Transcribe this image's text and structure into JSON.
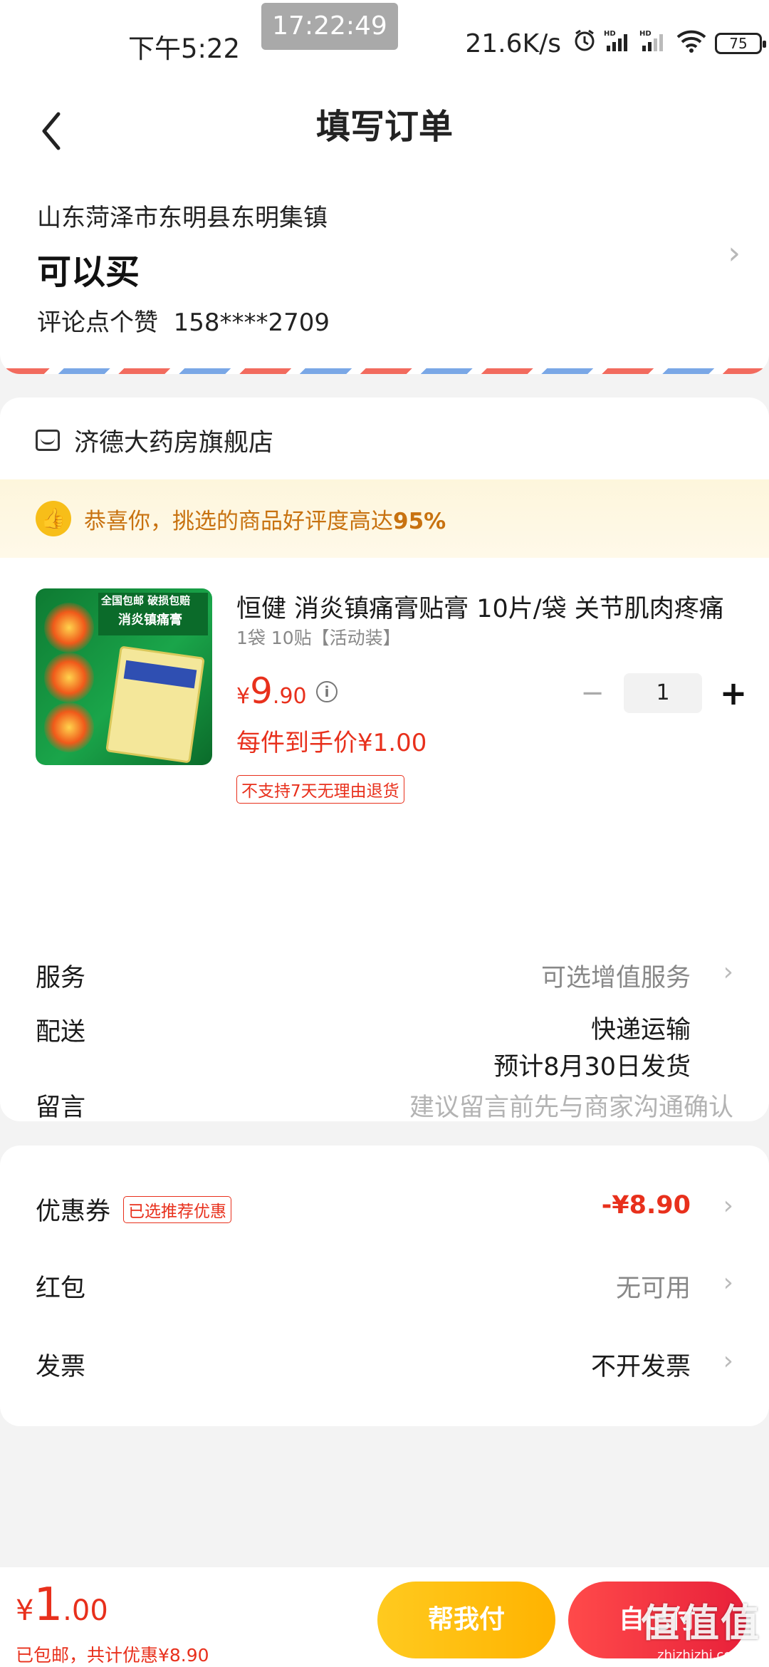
{
  "status_bar": {
    "time": "下午5:22",
    "clock_chip": "17:22:49",
    "net_speed": "21.6K/s",
    "battery": "75"
  },
  "nav": {
    "title": "填写订单"
  },
  "address": {
    "line": "山东菏泽市东明县东明集镇",
    "name": "可以买",
    "contact": "评论点个赞",
    "phone": "158****2709"
  },
  "store": {
    "name": "济德大药房旗舰店",
    "banner_prefix": "恭喜你，挑选的商品好评度高达",
    "banner_pct": "95%",
    "product": {
      "title": "恒健 消炎镇痛膏贴膏 10片/袋 关节肌肉疼痛",
      "spec": "1袋 10贴【活动装】",
      "price_yen": "¥",
      "price_int": "9",
      "price_dec": ".90",
      "quantity": "1",
      "each_price": "每件到手价¥1.00",
      "return_tag": "不支持7天无理由退货",
      "image_text_1": "全国包邮 破损包赔",
      "image_text_2": "消炎镇痛膏"
    },
    "service_label": "服务",
    "service_value": "可选增值服务",
    "delivery_label": "配送",
    "delivery_method": "快递运输",
    "delivery_eta": "预计8月30日发货",
    "message_label": "留言",
    "message_placeholder": "建议留言前先与商家沟通确认"
  },
  "discounts": {
    "coupon_label": "优惠券",
    "coupon_tag": "已选推荐优惠",
    "coupon_value": "-¥8.90",
    "redpack_label": "红包",
    "redpack_value": "无可用",
    "invoice_label": "发票",
    "invoice_value": "不开发票"
  },
  "bottom": {
    "total_yen": "¥",
    "total_int": "1",
    "total_dec": ".00",
    "summary": "已包邮，共计优惠¥8.90",
    "help_pay": "帮我付",
    "self_pay": "自己付"
  },
  "watermark": {
    "logo": "值值值",
    "url": "zhizhizhi.com"
  },
  "colors": {
    "accent_red": "#e8301c",
    "pay_yellow": "#ffb300",
    "banner_text": "#c87210"
  },
  "icons": [
    "back-arrow-icon",
    "alarm-icon",
    "signal-icon",
    "wifi-icon",
    "battery-icon",
    "store-icon",
    "thumbs-up-icon",
    "info-icon",
    "chevron-right-icon",
    "minus-icon",
    "plus-icon"
  ]
}
